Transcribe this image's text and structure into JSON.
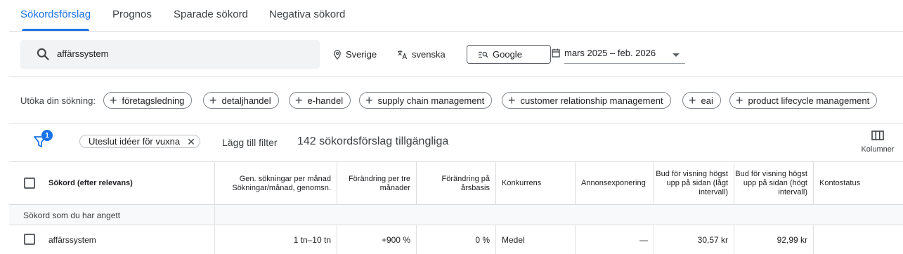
{
  "tabs": [
    {
      "label": "Sökordsförslag",
      "active": true
    },
    {
      "label": "Prognos",
      "active": false
    },
    {
      "label": "Sparade sökord",
      "active": false
    },
    {
      "label": "Negativa sökord",
      "active": false
    }
  ],
  "search": {
    "query": "affärssystem"
  },
  "targeting": {
    "location": "Sverige",
    "language": "svenska",
    "network": "Google",
    "date_range": "mars 2025 – feb. 2026"
  },
  "expand": {
    "label": "Utöka din sökning:",
    "chips": [
      "företagsledning",
      "detaljhandel",
      "e-handel",
      "supply chain management",
      "customer relationship management",
      "eai",
      "product lifecycle management"
    ]
  },
  "filters": {
    "badge_count": "1",
    "adult_chip": "Uteslut idéer för vuxna",
    "add_filter": "Lägg till filter",
    "count_text": "142 sökordsförslag tillgängliga",
    "columns_label": "Kolumner"
  },
  "table": {
    "headers": {
      "keyword": "Sökord (efter relevans)",
      "avg_searches": "Gen. sökningar per månad Sökningar/månad, genomsn.",
      "change_3m": "Förändring per tre månader",
      "change_yoy": "Förändring på årsbasis",
      "competition": "Konkurrens",
      "ad_impression": "Annonsexponering",
      "bid_low": "Bud för visning högst upp på sidan (lågt intervall)",
      "bid_high": "Bud för visning högst upp på sidan (högt intervall)",
      "account_status": "Kontostatus"
    },
    "section_label": "Sökord som du har angett",
    "rows": [
      {
        "keyword": "affärssystem",
        "avg_searches": "1 tn–10 tn",
        "change_3m": "+900 %",
        "change_yoy": "0 %",
        "competition": "Medel",
        "ad_impression": "—",
        "bid_low": "30,57 kr",
        "bid_high": "92,99 kr",
        "account_status": ""
      }
    ]
  },
  "colors": {
    "accent": "#1a73e8",
    "search_bg": "#f1f3f4",
    "section_bg": "#f8f9fa"
  }
}
